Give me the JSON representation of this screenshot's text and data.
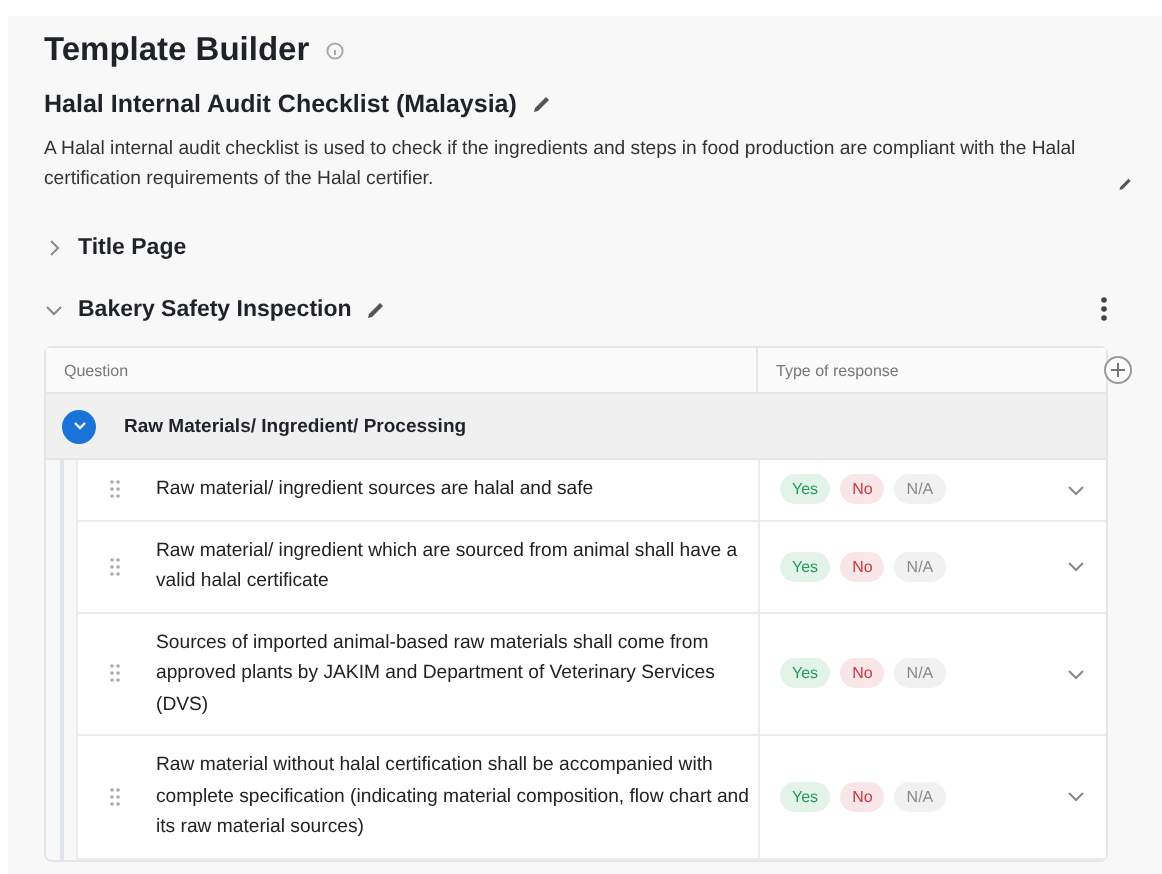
{
  "page": {
    "title": "Template Builder"
  },
  "template": {
    "title": "Halal Internal Audit Checklist (Malaysia)",
    "description": "A Halal internal audit checklist is used to check if the ingredients and steps in food production are compliant with the Halal certification requirements of the Halal certifier."
  },
  "sections": [
    {
      "title": "Title Page",
      "expanded": false
    },
    {
      "title": "Bakery Safety Inspection",
      "expanded": true,
      "table": {
        "columns": [
          "Question",
          "Type of response"
        ],
        "group": {
          "title": "Raw Materials/ Ingredient/ Processing",
          "expanded": true
        },
        "rows": [
          {
            "question": "Raw material/ ingredient sources are halal and safe",
            "responses": [
              {
                "label": "Yes",
                "color": "#1f9d55"
              },
              {
                "label": "No",
                "color": "#d0343e"
              },
              {
                "label": "N/A",
                "color": "#8a8a8a"
              }
            ]
          },
          {
            "question": "Raw material/ ingredient which are sourced from animal shall have a valid halal certificate",
            "responses": [
              {
                "label": "Yes",
                "color": "#1f9d55"
              },
              {
                "label": "No",
                "color": "#d0343e"
              },
              {
                "label": "N/A",
                "color": "#8a8a8a"
              }
            ]
          },
          {
            "question": "Sources of imported animal-based raw materials shall come from approved plants by JAKIM and Department of Veterinary Services (DVS)",
            "responses": [
              {
                "label": "Yes",
                "color": "#1f9d55"
              },
              {
                "label": "No",
                "color": "#d0343e"
              },
              {
                "label": "N/A",
                "color": "#8a8a8a"
              }
            ]
          },
          {
            "question": "Raw material without halal certification shall be accompanied with complete specification (indicating material composition, flow chart and its raw material sources)",
            "responses": [
              {
                "label": "Yes",
                "color": "#1f9d55"
              },
              {
                "label": "No",
                "color": "#d0343e"
              },
              {
                "label": "N/A",
                "color": "#8a8a8a"
              }
            ]
          }
        ]
      }
    }
  ]
}
